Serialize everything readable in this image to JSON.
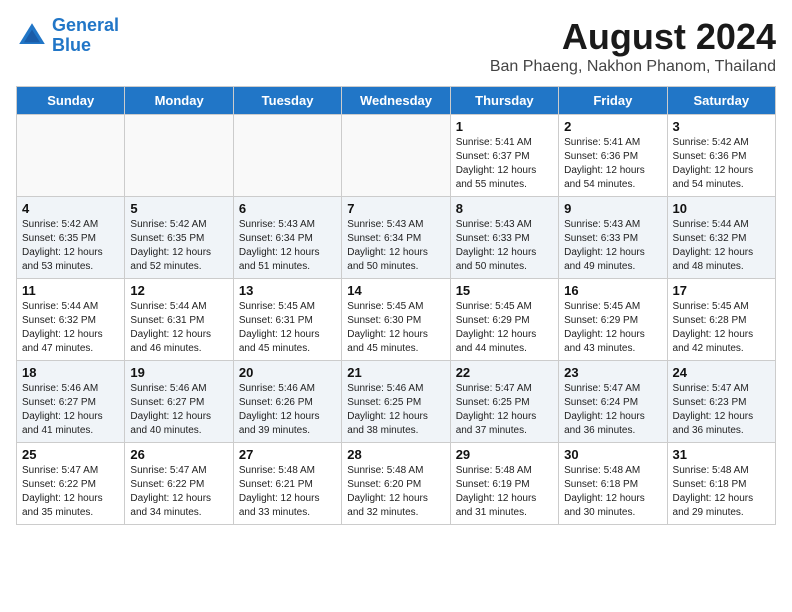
{
  "logo": {
    "line1": "General",
    "line2": "Blue"
  },
  "title": "August 2024",
  "subtitle": "Ban Phaeng, Nakhon Phanom, Thailand",
  "weekdays": [
    "Sunday",
    "Monday",
    "Tuesday",
    "Wednesday",
    "Thursday",
    "Friday",
    "Saturday"
  ],
  "weeks": [
    [
      {
        "day": "",
        "info": "",
        "empty": true
      },
      {
        "day": "",
        "info": "",
        "empty": true
      },
      {
        "day": "",
        "info": "",
        "empty": true
      },
      {
        "day": "",
        "info": "",
        "empty": true
      },
      {
        "day": "1",
        "info": "Sunrise: 5:41 AM\nSunset: 6:37 PM\nDaylight: 12 hours\nand 55 minutes."
      },
      {
        "day": "2",
        "info": "Sunrise: 5:41 AM\nSunset: 6:36 PM\nDaylight: 12 hours\nand 54 minutes."
      },
      {
        "day": "3",
        "info": "Sunrise: 5:42 AM\nSunset: 6:36 PM\nDaylight: 12 hours\nand 54 minutes."
      }
    ],
    [
      {
        "day": "4",
        "info": "Sunrise: 5:42 AM\nSunset: 6:35 PM\nDaylight: 12 hours\nand 53 minutes."
      },
      {
        "day": "5",
        "info": "Sunrise: 5:42 AM\nSunset: 6:35 PM\nDaylight: 12 hours\nand 52 minutes."
      },
      {
        "day": "6",
        "info": "Sunrise: 5:43 AM\nSunset: 6:34 PM\nDaylight: 12 hours\nand 51 minutes."
      },
      {
        "day": "7",
        "info": "Sunrise: 5:43 AM\nSunset: 6:34 PM\nDaylight: 12 hours\nand 50 minutes."
      },
      {
        "day": "8",
        "info": "Sunrise: 5:43 AM\nSunset: 6:33 PM\nDaylight: 12 hours\nand 50 minutes."
      },
      {
        "day": "9",
        "info": "Sunrise: 5:43 AM\nSunset: 6:33 PM\nDaylight: 12 hours\nand 49 minutes."
      },
      {
        "day": "10",
        "info": "Sunrise: 5:44 AM\nSunset: 6:32 PM\nDaylight: 12 hours\nand 48 minutes."
      }
    ],
    [
      {
        "day": "11",
        "info": "Sunrise: 5:44 AM\nSunset: 6:32 PM\nDaylight: 12 hours\nand 47 minutes."
      },
      {
        "day": "12",
        "info": "Sunrise: 5:44 AM\nSunset: 6:31 PM\nDaylight: 12 hours\nand 46 minutes."
      },
      {
        "day": "13",
        "info": "Sunrise: 5:45 AM\nSunset: 6:31 PM\nDaylight: 12 hours\nand 45 minutes."
      },
      {
        "day": "14",
        "info": "Sunrise: 5:45 AM\nSunset: 6:30 PM\nDaylight: 12 hours\nand 45 minutes."
      },
      {
        "day": "15",
        "info": "Sunrise: 5:45 AM\nSunset: 6:29 PM\nDaylight: 12 hours\nand 44 minutes."
      },
      {
        "day": "16",
        "info": "Sunrise: 5:45 AM\nSunset: 6:29 PM\nDaylight: 12 hours\nand 43 minutes."
      },
      {
        "day": "17",
        "info": "Sunrise: 5:45 AM\nSunset: 6:28 PM\nDaylight: 12 hours\nand 42 minutes."
      }
    ],
    [
      {
        "day": "18",
        "info": "Sunrise: 5:46 AM\nSunset: 6:27 PM\nDaylight: 12 hours\nand 41 minutes."
      },
      {
        "day": "19",
        "info": "Sunrise: 5:46 AM\nSunset: 6:27 PM\nDaylight: 12 hours\nand 40 minutes."
      },
      {
        "day": "20",
        "info": "Sunrise: 5:46 AM\nSunset: 6:26 PM\nDaylight: 12 hours\nand 39 minutes."
      },
      {
        "day": "21",
        "info": "Sunrise: 5:46 AM\nSunset: 6:25 PM\nDaylight: 12 hours\nand 38 minutes."
      },
      {
        "day": "22",
        "info": "Sunrise: 5:47 AM\nSunset: 6:25 PM\nDaylight: 12 hours\nand 37 minutes."
      },
      {
        "day": "23",
        "info": "Sunrise: 5:47 AM\nSunset: 6:24 PM\nDaylight: 12 hours\nand 36 minutes."
      },
      {
        "day": "24",
        "info": "Sunrise: 5:47 AM\nSunset: 6:23 PM\nDaylight: 12 hours\nand 36 minutes."
      }
    ],
    [
      {
        "day": "25",
        "info": "Sunrise: 5:47 AM\nSunset: 6:22 PM\nDaylight: 12 hours\nand 35 minutes."
      },
      {
        "day": "26",
        "info": "Sunrise: 5:47 AM\nSunset: 6:22 PM\nDaylight: 12 hours\nand 34 minutes."
      },
      {
        "day": "27",
        "info": "Sunrise: 5:48 AM\nSunset: 6:21 PM\nDaylight: 12 hours\nand 33 minutes."
      },
      {
        "day": "28",
        "info": "Sunrise: 5:48 AM\nSunset: 6:20 PM\nDaylight: 12 hours\nand 32 minutes."
      },
      {
        "day": "29",
        "info": "Sunrise: 5:48 AM\nSunset: 6:19 PM\nDaylight: 12 hours\nand 31 minutes."
      },
      {
        "day": "30",
        "info": "Sunrise: 5:48 AM\nSunset: 6:18 PM\nDaylight: 12 hours\nand 30 minutes."
      },
      {
        "day": "31",
        "info": "Sunrise: 5:48 AM\nSunset: 6:18 PM\nDaylight: 12 hours\nand 29 minutes."
      }
    ]
  ]
}
